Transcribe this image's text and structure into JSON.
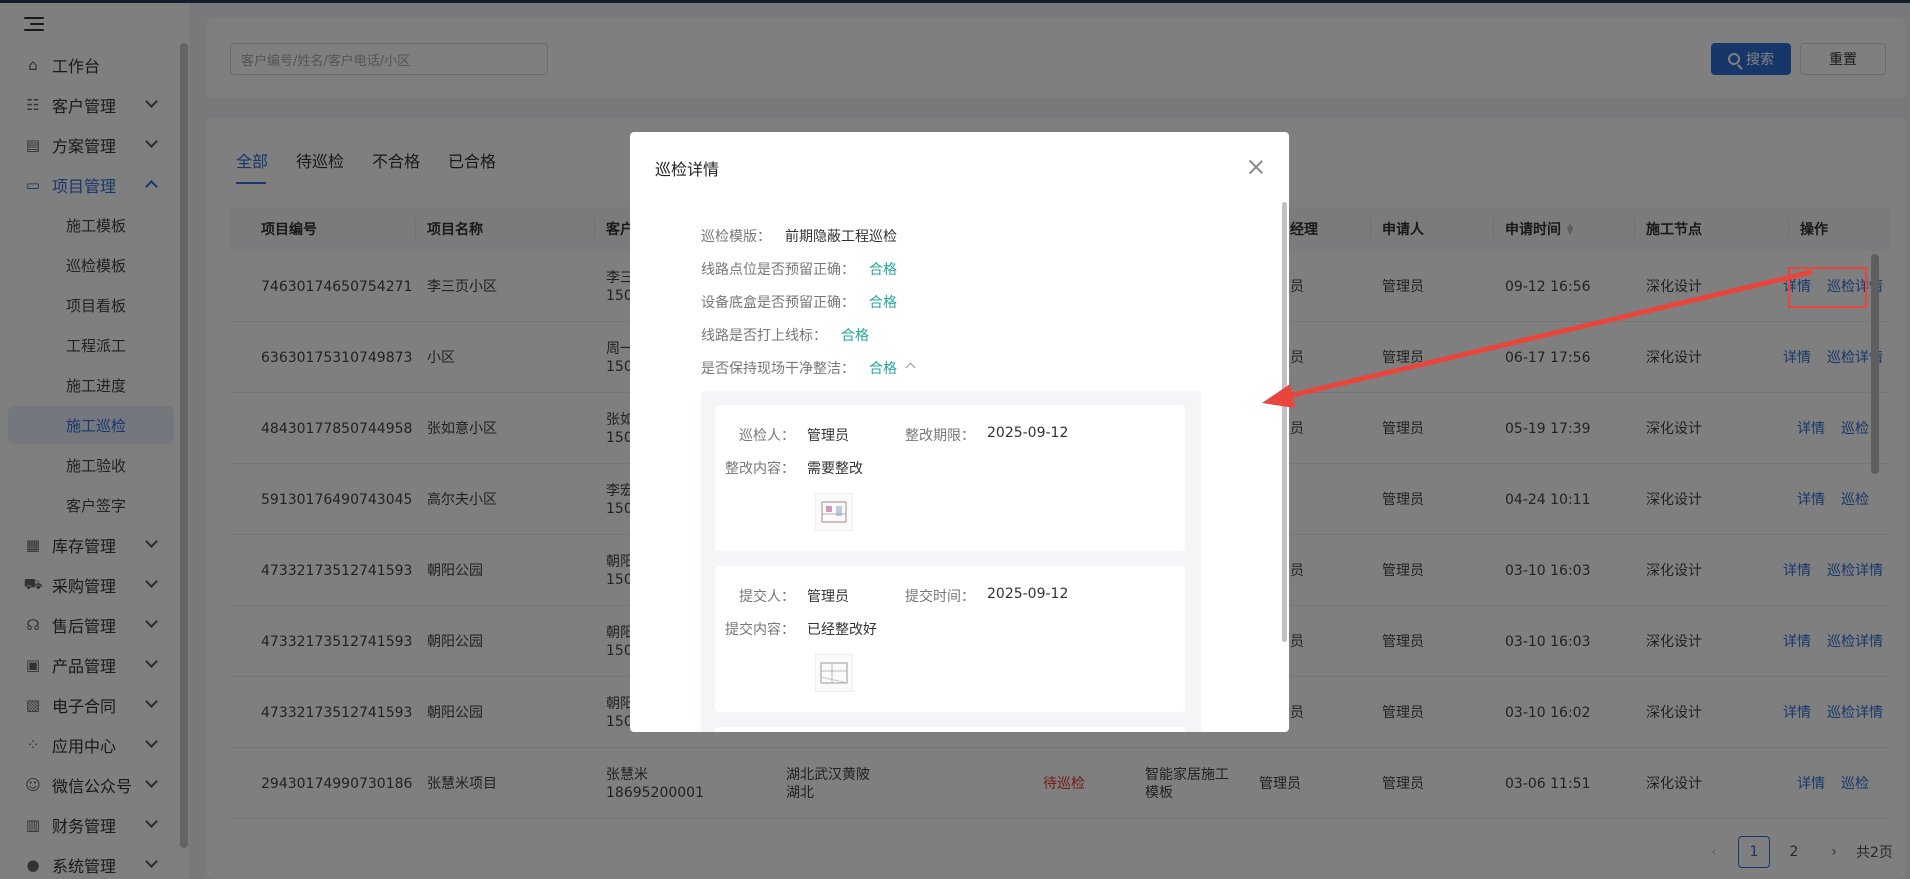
{
  "sidebar": {
    "items": [
      {
        "label": "工作台",
        "icon": "home-icon"
      },
      {
        "label": "客户管理",
        "icon": "user-card-icon"
      },
      {
        "label": "方案管理",
        "icon": "document-icon"
      },
      {
        "label": "项目管理",
        "icon": "folder-icon"
      }
    ],
    "project_sub": [
      "施工模板",
      "巡检模板",
      "项目看板",
      "工程派工",
      "施工进度",
      "施工巡检",
      "施工验收",
      "客户签字"
    ],
    "items_bottom": [
      {
        "label": "库存管理",
        "icon": "stock-icon"
      },
      {
        "label": "采购管理",
        "icon": "cart-icon"
      },
      {
        "label": "售后管理",
        "icon": "headset-icon"
      },
      {
        "label": "产品管理",
        "icon": "box-icon"
      },
      {
        "label": "电子合同",
        "icon": "contract-icon"
      },
      {
        "label": "应用中心",
        "icon": "apps-icon"
      },
      {
        "label": "微信公众号",
        "icon": "wechat-icon"
      },
      {
        "label": "财务管理",
        "icon": "finance-icon"
      },
      {
        "label": "系统管理",
        "icon": "settings-icon"
      }
    ]
  },
  "search": {
    "placeholder": "客户编号/姓名/客户电话/小区",
    "search_label": "搜索",
    "reset_label": "重置"
  },
  "tabs": [
    "全部",
    "待巡检",
    "不合格",
    "已合格"
  ],
  "table": {
    "headers": {
      "project_no": "项目编号",
      "project_name": "项目名称",
      "customer": "客户",
      "manager": "经理",
      "applicant": "申请人",
      "apply_time": "申请时间",
      "node": "施工节点",
      "actions": "操作"
    },
    "rows": [
      {
        "no": "74630174650754271",
        "name": "李三页小区",
        "cust1": "李三",
        "cust2": "150",
        "mgr": "员",
        "applicant": "管理员",
        "time": "09-12 16:56",
        "node": "深化设计",
        "a1": "详情",
        "a2": "巡检详情"
      },
      {
        "no": "63630175310749873",
        "name": "小区",
        "cust1": "周一",
        "cust2": "150",
        "mgr": "员",
        "applicant": "管理员",
        "time": "06-17 17:56",
        "node": "深化设计",
        "a1": "详情",
        "a2": "巡检详情"
      },
      {
        "no": "48430177850744958",
        "name": "张如意小区",
        "cust1": "张如",
        "cust2": "150",
        "mgr": "员",
        "applicant": "管理员",
        "time": "05-19 17:39",
        "node": "深化设计",
        "a1": "详情",
        "a2": "巡检"
      },
      {
        "no": "59130176490743045",
        "name": "高尔夫小区",
        "cust1": "李宏",
        "cust2": "150",
        "mgr": "",
        "applicant": "管理员",
        "time": "04-24 10:11",
        "node": "深化设计",
        "a1": "详情",
        "a2": "巡检"
      },
      {
        "no": "47332173512741593",
        "name": "朝阳公园",
        "cust1": "朝阳",
        "cust2": "150",
        "mgr": "员",
        "applicant": "管理员",
        "time": "03-10 16:03",
        "node": "深化设计",
        "a1": "详情",
        "a2": "巡检详情"
      },
      {
        "no": "47332173512741593",
        "name": "朝阳公园",
        "cust1": "朝阳",
        "cust2": "150",
        "mgr": "员",
        "applicant": "管理员",
        "time": "03-10 16:03",
        "node": "深化设计",
        "a1": "详情",
        "a2": "巡检详情"
      },
      {
        "no": "47332173512741593",
        "name": "朝阳公园",
        "cust1": "朝阳",
        "cust2": "150",
        "mgr": "员",
        "applicant": "管理员",
        "time": "03-10 16:02",
        "node": "深化设计",
        "a1": "详情",
        "a2": "巡检详情"
      }
    ],
    "last_row": {
      "no": "29430174990730186",
      "name": "张慧米项目",
      "cust1": "张慧米",
      "cust2": "18695200001",
      "addr1": "湖北武汉黄陂",
      "addr2": "湖北",
      "status": "待巡检",
      "template1": "智能家居施工",
      "template2": "模板",
      "mgr": "管理员",
      "applicant": "管理员",
      "time": "03-06 11:51",
      "node": "深化设计",
      "a1": "详情",
      "a2": "巡检"
    }
  },
  "pagination": {
    "prev": "‹",
    "pages": [
      "1",
      "2"
    ],
    "next": "›",
    "total": "共2页"
  },
  "modal": {
    "title": "巡检详情",
    "fields": [
      {
        "label": "巡检模版：",
        "value": "前期隐蔽工程巡检"
      },
      {
        "label": "线路点位是否预留正确：",
        "value": "合格"
      },
      {
        "label": "设备底盒是否预留正确：",
        "value": "合格"
      },
      {
        "label": "线路是否打上线标：",
        "value": "合格"
      },
      {
        "label": "是否保持现场干净整洁：",
        "value": "合格"
      }
    ],
    "card1": {
      "inspector_label": "巡检人：",
      "inspector": "管理员",
      "deadline_label": "整改期限：",
      "deadline": "2025-09-12",
      "content_label": "整改内容：",
      "content": "需要整改"
    },
    "card2": {
      "submitter_label": "提交人：",
      "submitter": "管理员",
      "time_label": "提交时间：",
      "time": "2025-09-12",
      "content_label": "提交内容：",
      "content": "已经整改好"
    }
  },
  "colors": {
    "accent": "#2f6fd6",
    "ok": "#26a69a",
    "warning": "#e53935",
    "annotation": "#e8453c"
  }
}
